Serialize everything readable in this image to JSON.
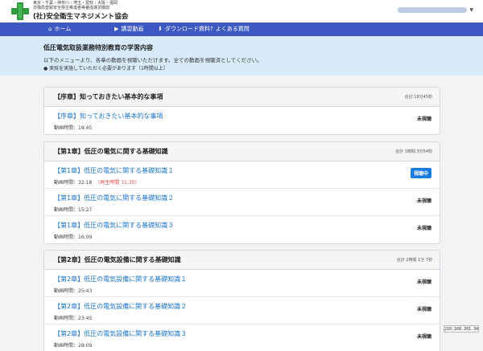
{
  "header": {
    "org_regions": "東京・千葉・神奈川・埼玉・愛知・大阪・福岡",
    "org_desc": "労働局登録安全衛生推進者等養成講習機関",
    "org_name": "(社)安全衛生マネジメント協会"
  },
  "nav": {
    "items": [
      {
        "label": "ホーム",
        "icon": "home-icon"
      },
      {
        "label": "講習動画",
        "icon": "video-icon"
      },
      {
        "label": "ダウンロード資料",
        "icon": "download-icon"
      },
      {
        "label": "よくある質問",
        "icon": "question-icon"
      }
    ]
  },
  "info": {
    "title": "低圧電気取扱業務特別教育の学習内容",
    "line": "以下のメニューより、各章の動画を視聴いただけます。全ての動画を視聴済としてください。",
    "note": "実技を実施していただく必要があります（1時間以上）"
  },
  "sections": [
    {
      "title": "【序章】知っておきたい基本的な事項",
      "total": "合計 18分45秒",
      "videos": [
        {
          "title": "【序章】知っておきたい基本的な事項",
          "time_label": "動画時間：18:45",
          "status": "未視聴",
          "active": false
        }
      ]
    },
    {
      "title": "【第1章】低圧の電気に関する基礎知識",
      "total": "合計 1時間 3分54秒",
      "videos": [
        {
          "title": "【第1章】低圧の電気に関する基礎知識１",
          "time_label": "動画時間：32:18",
          "resume": "（再生時間 11:35）",
          "status": "視聴中",
          "active": true
        },
        {
          "title": "【第1章】低圧の電気に関する基礎知識２",
          "time_label": "動画時間：15:27",
          "status": "未視聴",
          "active": false
        },
        {
          "title": "【第1章】低圧の電気に関する基礎知識３",
          "time_label": "動画時間：16:09",
          "status": "未視聴",
          "active": false
        }
      ]
    },
    {
      "title": "【第2章】低圧の電気設備に関する基礎知識",
      "total": "合計 2時間 1分 7秒",
      "videos": [
        {
          "title": "【第2章】低圧の電気設備に関する基礎知識１",
          "time_label": "動画時間：25:43",
          "status": "未視聴",
          "active": false
        },
        {
          "title": "【第2章】低圧の電気設備に関する基礎知識２",
          "time_label": "動画時間：23:45",
          "status": "未視聴",
          "active": false
        },
        {
          "title": "【第2章】低圧の電気設備に関する基礎知識３",
          "time_label": "動画時間：28:09",
          "status": "未視聴",
          "active": false
        }
      ]
    }
  ],
  "ip_address": "210.168.201.34",
  "colors": {
    "nav_bg": "#3d59c1",
    "info_bg": "#d7ebf8",
    "link": "#1a73c8",
    "active_badge": "#1a7be0",
    "logo_green": "#2e9a3e",
    "resume_red": "#e04a4a"
  }
}
